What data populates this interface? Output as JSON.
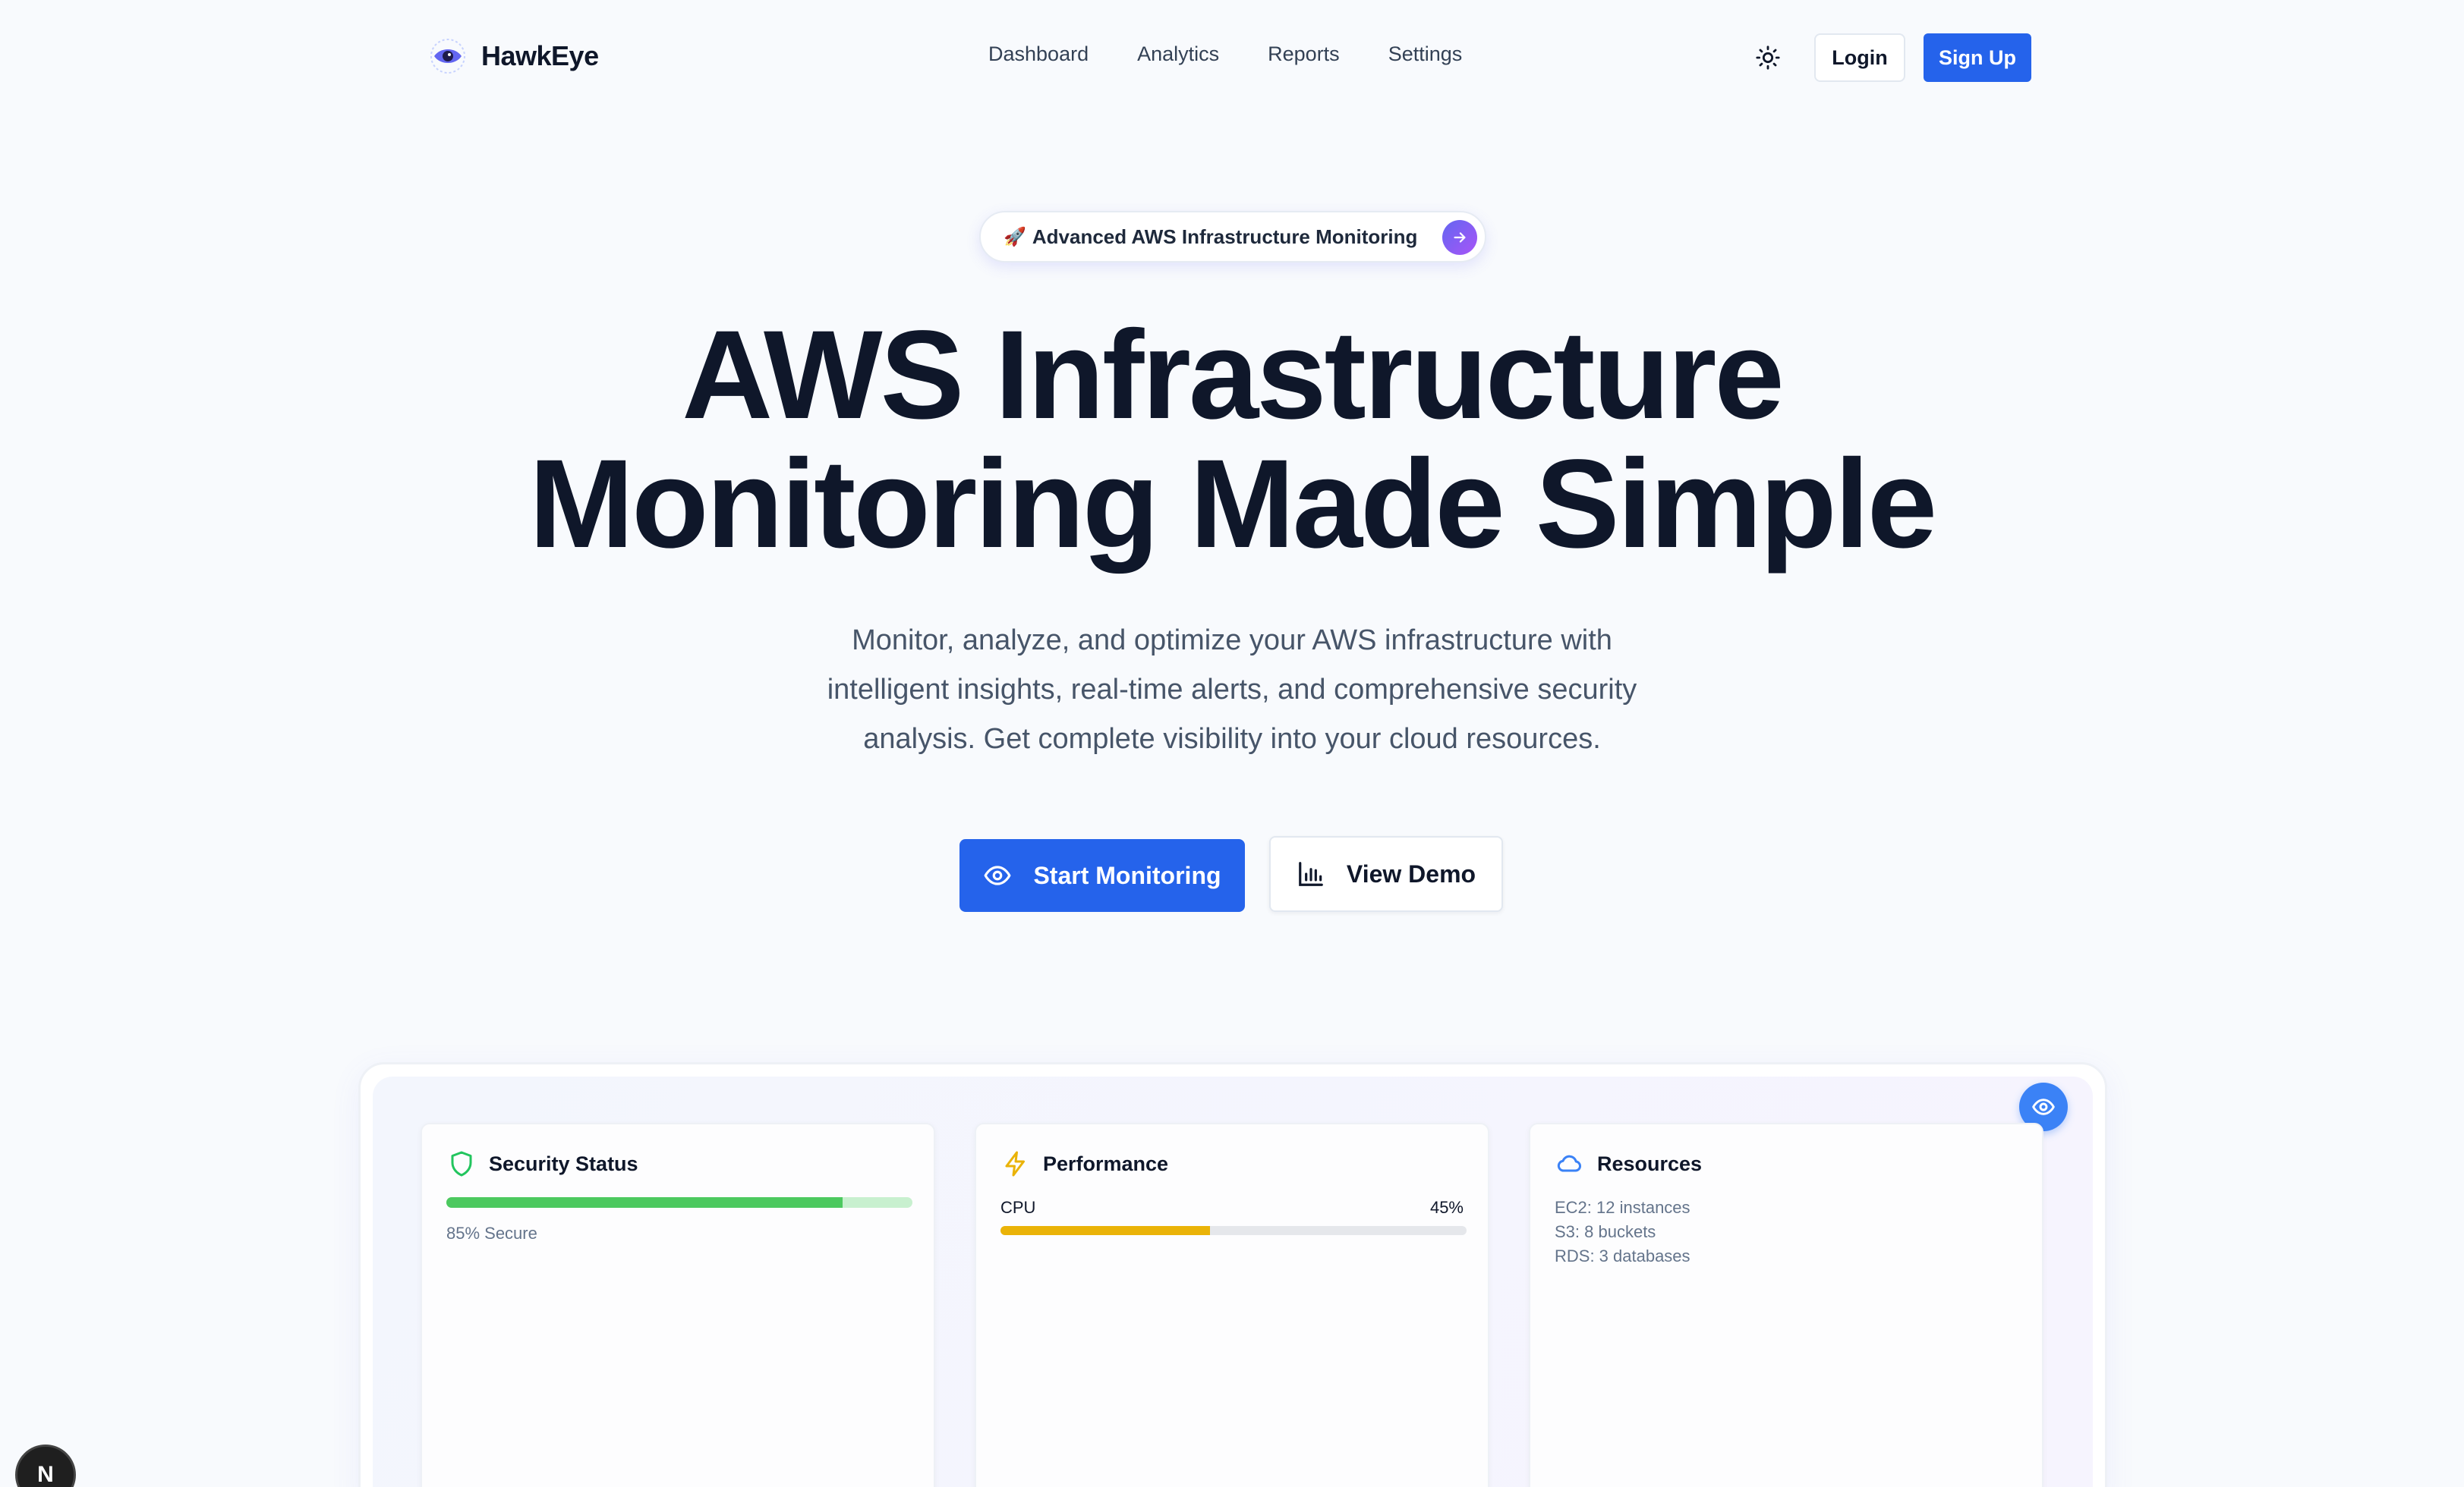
{
  "brand": {
    "name": "HawkEye",
    "logo_icon": "eye-icon"
  },
  "nav": {
    "links": [
      "Dashboard",
      "Analytics",
      "Reports",
      "Settings"
    ],
    "theme_icon": "sun-icon",
    "login_label": "Login",
    "signup_label": "Sign Up"
  },
  "hero": {
    "badge_emoji": "🚀",
    "badge_text": "Advanced AWS Infrastructure Monitoring",
    "title_line1": "AWS Infrastructure",
    "title_line2": "Monitoring Made Simple",
    "subtitle_line1": "Monitor, analyze, and optimize your AWS infrastructure with",
    "subtitle_line2": "intelligent insights, real-time alerts, and comprehensive security",
    "subtitle_line3": "analysis. Get complete visibility into your cloud resources.",
    "primary_cta": "Start Monitoring",
    "secondary_cta": "View Demo"
  },
  "dashboard": {
    "security": {
      "title": "Security Status",
      "secure_percent": 85,
      "caption": "85% Secure"
    },
    "performance": {
      "title": "Performance",
      "metric": "CPU",
      "value_label": "45%",
      "value_percent": 45
    },
    "resources": {
      "title": "Resources",
      "items": [
        "EC2: 12 instances",
        "S3: 8 buckets",
        "RDS: 3 databases"
      ]
    }
  },
  "colors": {
    "primary": "#2563eb",
    "security_bar": "#4cc95f",
    "security_track": "#c8f0cf",
    "performance_bar": "#eab308",
    "performance_track": "#e5e7eb"
  },
  "next_badge": "N"
}
